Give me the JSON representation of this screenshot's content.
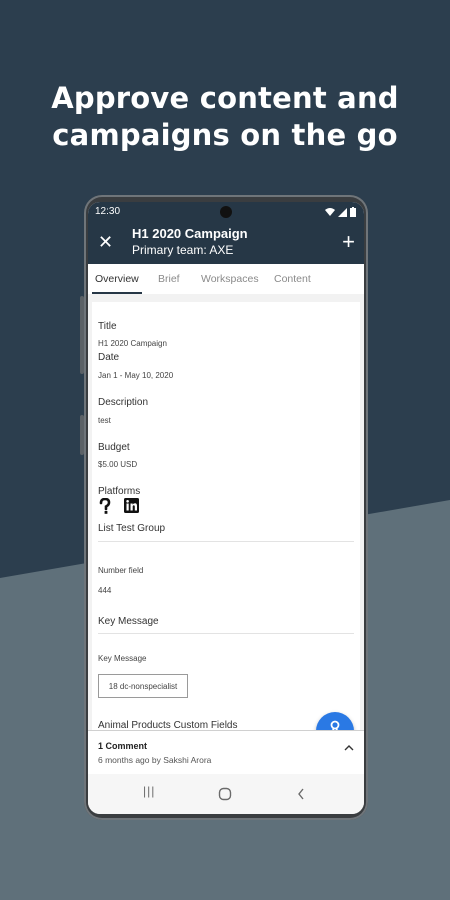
{
  "headline": {
    "line1": "Approve content and",
    "line2": "campaigns on the go"
  },
  "colors": {
    "background": "#2c3e4e",
    "lower_background": "#5f707a",
    "app_bar": "#263746",
    "fab": "#2a79e4"
  },
  "status_bar": {
    "time": "12:30",
    "icons": [
      "wifi-icon",
      "signal-icon",
      "battery-icon"
    ]
  },
  "app_bar": {
    "close_icon": "close-icon",
    "title": "H1 2020 Campaign",
    "subtitle": "Primary team: AXE",
    "add_icon": "plus-icon"
  },
  "tabs": [
    {
      "label": "Overview",
      "active": true
    },
    {
      "label": "Brief",
      "active": false
    },
    {
      "label": "Workspaces",
      "active": false
    },
    {
      "label": "Content",
      "active": false
    }
  ],
  "fields": {
    "title_label": "Title",
    "title_value": "H1 2020 Campaign",
    "date_label": "Date",
    "date_value": "Jan 1 - May 10, 2020",
    "description_label": "Description",
    "description_value": "test",
    "budget_label": "Budget",
    "budget_value": "$5.00 USD",
    "platforms_label": "Platforms",
    "platform_icons": [
      "question-icon",
      "linkedin-icon"
    ],
    "list_test_group": "List Test Group",
    "number_field_label": "Number field",
    "number_field_value": "444",
    "key_message_section": "Key Message",
    "key_message_label": "Key Message",
    "key_message_chip": "18 dc-nonspecialist",
    "animal_products": "Animal Products Custom Fields"
  },
  "fab": {
    "icon": "stamp-icon"
  },
  "comments": {
    "title": "1 Comment",
    "subtitle": "6 months ago by Sakshi Arora",
    "toggle_icon": "chevron-up-icon"
  },
  "nav_bar": {
    "recents_icon": "recents-icon",
    "home_icon": "home-icon",
    "back_icon": "back-icon"
  }
}
